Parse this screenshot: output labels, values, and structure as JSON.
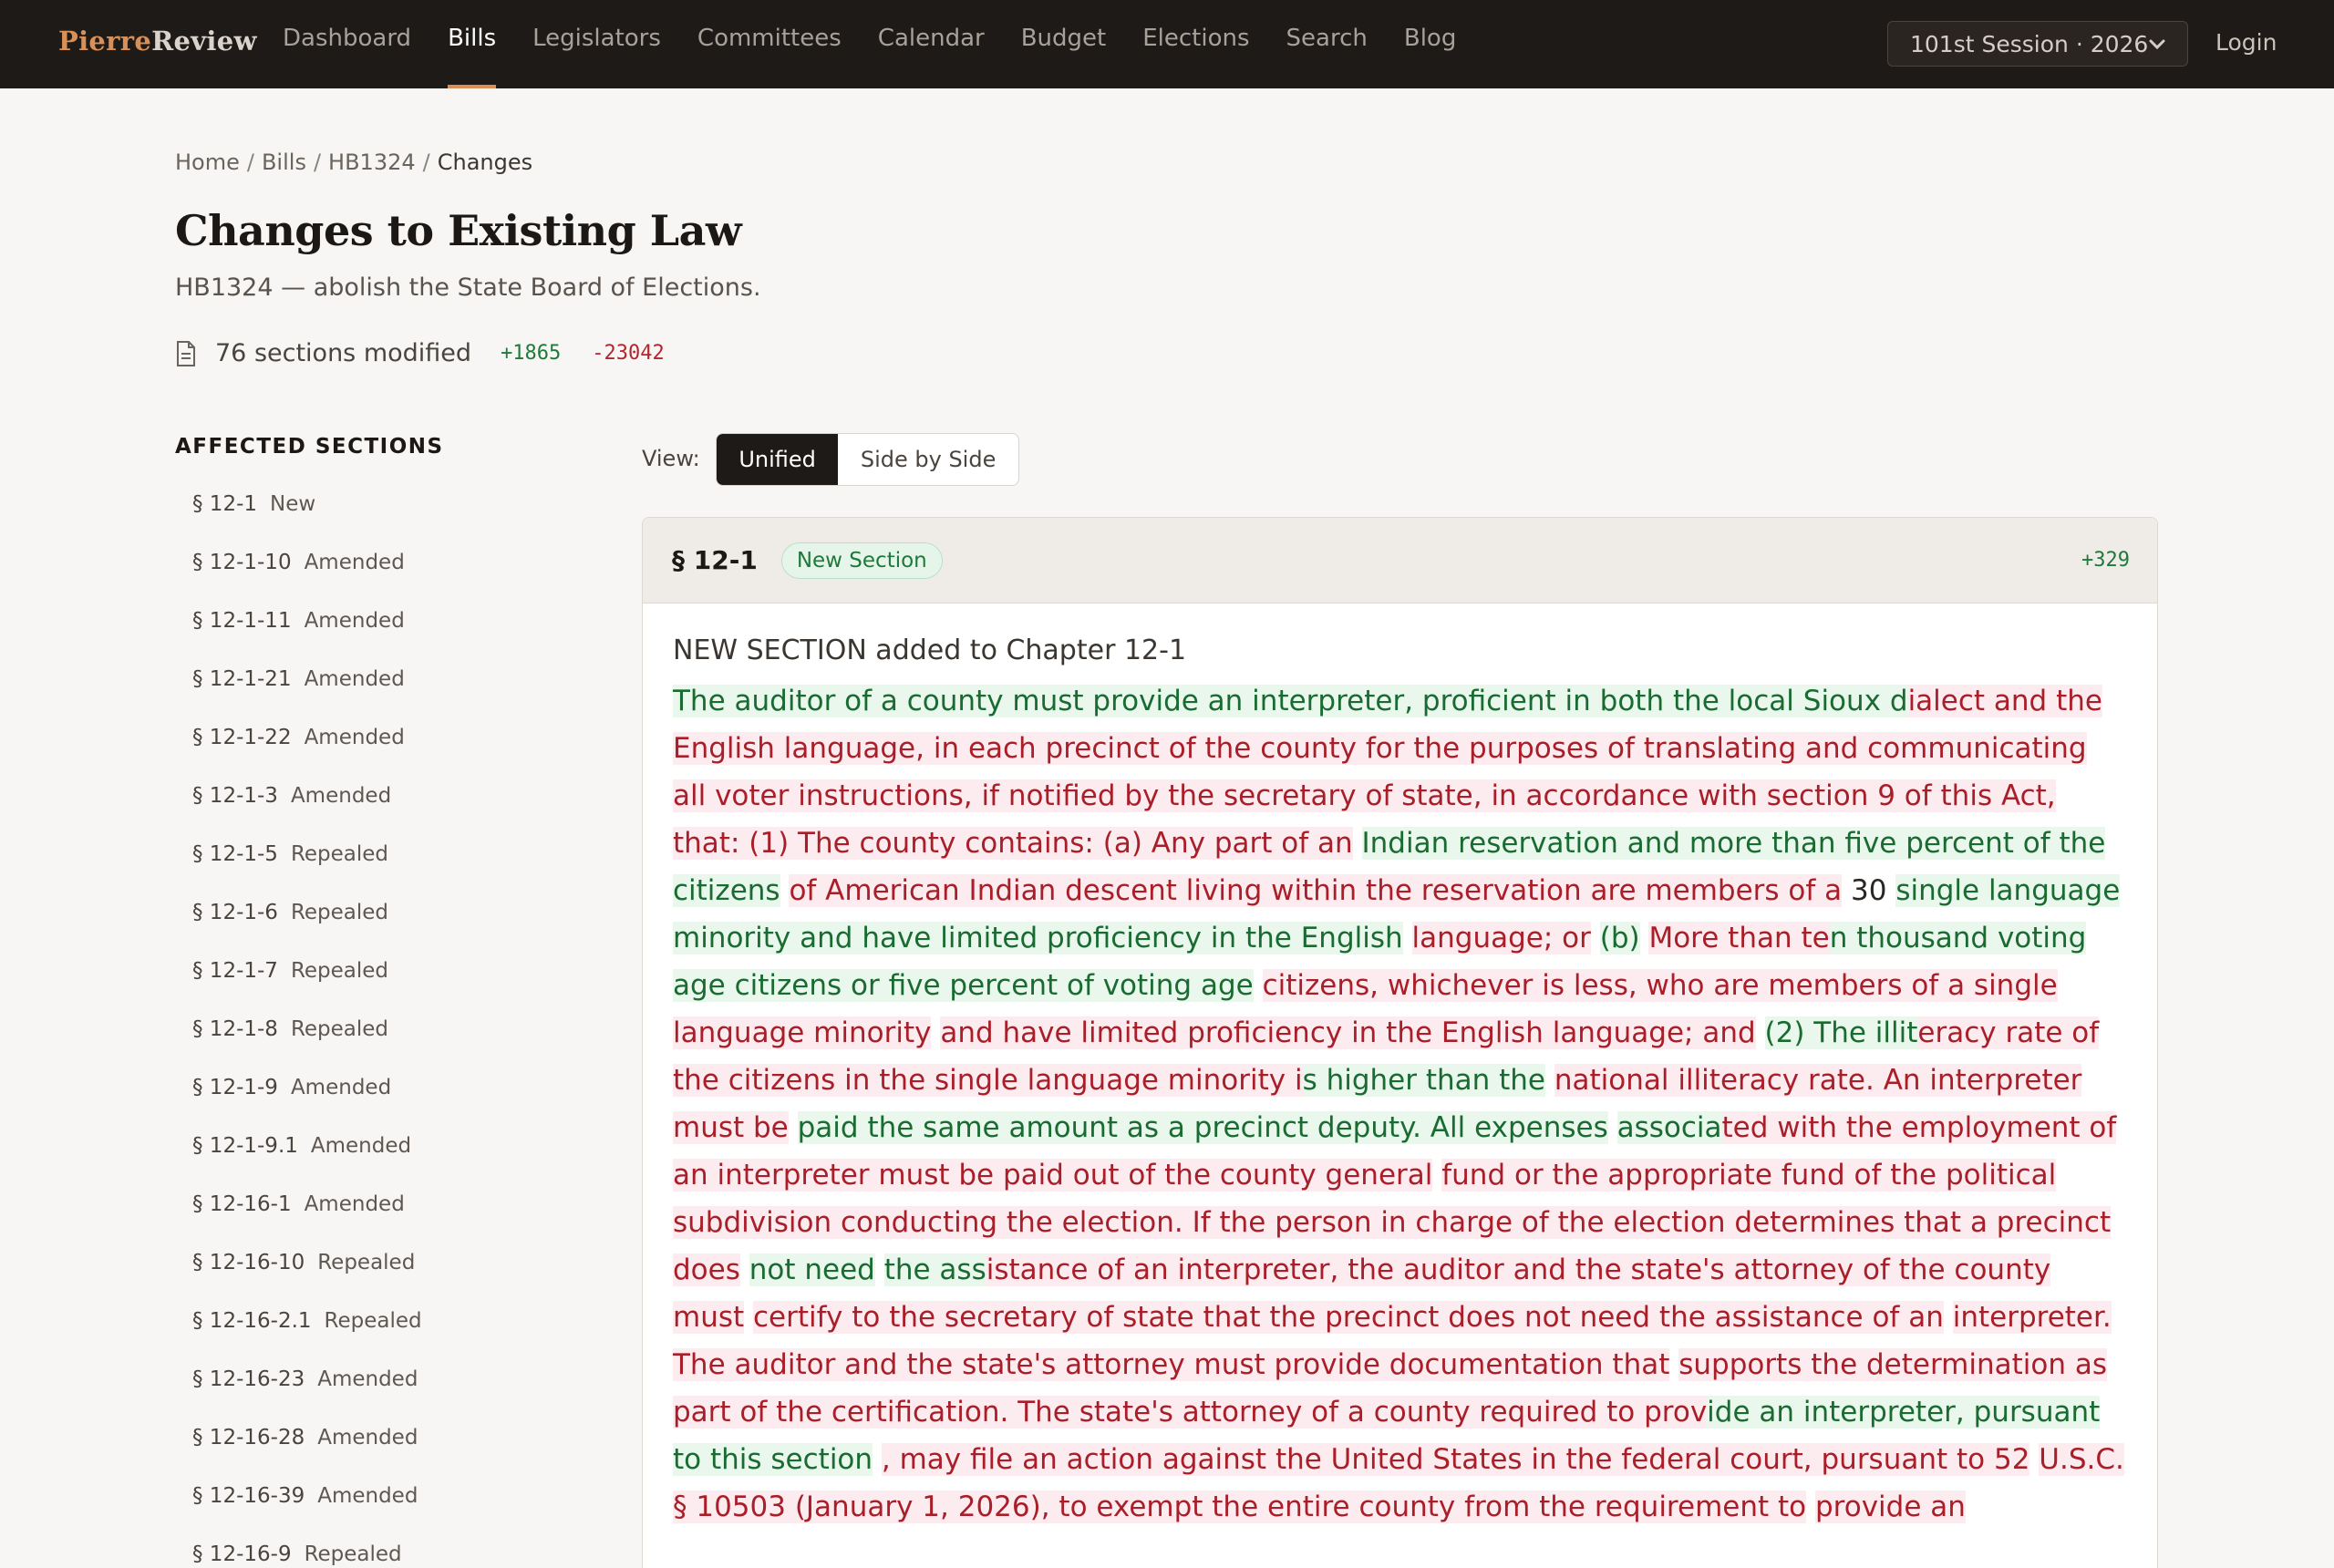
{
  "nav": {
    "logo_part1": "Pierre",
    "logo_part2": "Review",
    "links": [
      "Dashboard",
      "Bills",
      "Legislators",
      "Committees",
      "Calendar",
      "Budget",
      "Elections",
      "Search",
      "Blog"
    ],
    "active": "Bills",
    "session": "101st Session · 2026",
    "login": "Login"
  },
  "breadcrumb": [
    "Home",
    "Bills",
    "HB1324",
    "Changes"
  ],
  "page": {
    "title": "Changes to Existing Law",
    "subtitle": "HB1324 — abolish the State Board of Elections.",
    "sections_modified": "76 sections modified",
    "additions": "+1865",
    "deletions": "-23042"
  },
  "sidebar": {
    "heading": "AFFECTED SECTIONS",
    "items": [
      {
        "section": "§ 12-1",
        "status": "New"
      },
      {
        "section": "§ 12-1-10",
        "status": "Amended"
      },
      {
        "section": "§ 12-1-11",
        "status": "Amended"
      },
      {
        "section": "§ 12-1-21",
        "status": "Amended"
      },
      {
        "section": "§ 12-1-22",
        "status": "Amended"
      },
      {
        "section": "§ 12-1-3",
        "status": "Amended"
      },
      {
        "section": "§ 12-1-5",
        "status": "Repealed"
      },
      {
        "section": "§ 12-1-6",
        "status": "Repealed"
      },
      {
        "section": "§ 12-1-7",
        "status": "Repealed"
      },
      {
        "section": "§ 12-1-8",
        "status": "Repealed"
      },
      {
        "section": "§ 12-1-9",
        "status": "Amended"
      },
      {
        "section": "§ 12-1-9.1",
        "status": "Amended"
      },
      {
        "section": "§ 12-16-1",
        "status": "Amended"
      },
      {
        "section": "§ 12-16-10",
        "status": "Repealed"
      },
      {
        "section": "§ 12-16-2.1",
        "status": "Repealed"
      },
      {
        "section": "§ 12-16-23",
        "status": "Amended"
      },
      {
        "section": "§ 12-16-28",
        "status": "Amended"
      },
      {
        "section": "§ 12-16-39",
        "status": "Amended"
      },
      {
        "section": "§ 12-16-9",
        "status": "Repealed"
      }
    ]
  },
  "view": {
    "label": "View:",
    "options": [
      "Unified",
      "Side by Side"
    ],
    "selected": "Unified"
  },
  "card": {
    "section": "§ 12-1",
    "badge": "New Section",
    "count": "+329",
    "intro": "NEW SECTION added to Chapter 12-1",
    "segments": [
      {
        "type": "add",
        "text": " The auditor of a county must provide an interpreter, proficient in both the local "
      },
      {
        "type": "plain",
        "text": " "
      },
      {
        "type": "add",
        "text": "Sioux d"
      },
      {
        "type": "del",
        "text": "ialect and the English language, in each precinct of the county for the purposes of "
      },
      {
        "type": "plain",
        "text": " "
      },
      {
        "type": "del",
        "text": "translating and communicating all voter instructions, if notified by the secretary of state, "
      },
      {
        "type": "plain",
        "text": " "
      },
      {
        "type": "del",
        "text": "in accordance with section 9 of this Act, that: "
      },
      {
        "type": "plain",
        "text": " "
      },
      {
        "type": "del",
        "text": "(1) The county contains: "
      },
      {
        "type": "plain",
        "text": " "
      },
      {
        "type": "del",
        "text": "(a) Any part of an"
      },
      {
        "type": "plain",
        "text": " "
      },
      {
        "type": "add",
        "text": "Indian reservation and more than five percent of the citizens"
      },
      {
        "type": "plain",
        "text": " "
      },
      {
        "type": "del",
        "text": "of American Indian descent living within the reservation are members of a"
      },
      {
        "type": "plain",
        "text": " 30 "
      },
      {
        "type": "add",
        "text": "single language minority and have limited proficiency in the English"
      },
      {
        "type": "plain",
        "text": " "
      },
      {
        "type": "del",
        "text": "language; or"
      },
      {
        "type": "plain",
        "text": " "
      },
      {
        "type": "add",
        "text": "(b)"
      },
      {
        "type": "plain",
        "text": " "
      },
      {
        "type": "del",
        "text": "More than te"
      },
      {
        "type": "add",
        "text": "n thousand voting age citizens or five percent of voting age"
      },
      {
        "type": "plain",
        "text": " "
      },
      {
        "type": "del",
        "text": "citizens, whichever is less, who are members of a single language minority"
      },
      {
        "type": "plain",
        "text": " "
      },
      {
        "type": "del",
        "text": "and have limited proficiency in the English language; and"
      },
      {
        "type": "plain",
        "text": " "
      },
      {
        "type": "add",
        "text": "(2) The illit"
      },
      {
        "type": "del",
        "text": "eracy rate of the citizens in the single language minority i"
      },
      {
        "type": "add",
        "text": "s higher than the"
      },
      {
        "type": "plain",
        "text": " "
      },
      {
        "type": "del",
        "text": "national illiteracy rate. "
      },
      {
        "type": "plain",
        "text": " "
      },
      {
        "type": "del",
        "text": "An interpreter must be"
      },
      {
        "type": "plain",
        "text": " "
      },
      {
        "type": "add",
        "text": "paid the same amount as a precinct deputy. All expenses"
      },
      {
        "type": "plain",
        "text": " "
      },
      {
        "type": "add",
        "text": "associa"
      },
      {
        "type": "del",
        "text": "ted with the employment of an interpreter must be paid out of the county general"
      },
      {
        "type": "plain",
        "text": " "
      },
      {
        "type": "del",
        "text": "fund or the appropriate fund of the political subdivision conducting the election. "
      },
      {
        "type": "plain",
        "text": " "
      },
      {
        "type": "del",
        "text": "If the person in charge of the election determines that a precinct does"
      },
      {
        "type": "plain",
        "text": " "
      },
      {
        "type": "add",
        "text": "not need"
      },
      {
        "type": "plain",
        "text": " "
      },
      {
        "type": "add",
        "text": "the ass"
      },
      {
        "type": "del",
        "text": "istance of an interpreter, the auditor and the state's attorney of the county must"
      },
      {
        "type": "plain",
        "text": " "
      },
      {
        "type": "del",
        "text": "certify to the secretary of state that the precinct does not need the assistance of an"
      },
      {
        "type": "plain",
        "text": " "
      },
      {
        "type": "del",
        "text": "interpreter. The auditor and the state's attorney must provide documentation that"
      },
      {
        "type": "plain",
        "text": " "
      },
      {
        "type": "del",
        "text": "supports the determination as part of the certification. "
      },
      {
        "type": "plain",
        "text": " "
      },
      {
        "type": "del",
        "text": "The state's attorney of a county required to prov"
      },
      {
        "type": "add",
        "text": "ide an interpreter, pursuant to this section"
      },
      {
        "type": "plain",
        "text": " "
      },
      {
        "type": "del",
        "text": ", may file an action against the United States in the federal court, pursuant to 52"
      },
      {
        "type": "plain",
        "text": " "
      },
      {
        "type": "del",
        "text": "U.S.C. § 10503 (January 1, 2026), to exempt the entire county from the requirement to"
      },
      {
        "type": "plain",
        "text": " "
      },
      {
        "type": "del",
        "text": "provide an"
      }
    ]
  },
  "colors": {
    "nav_bg": "#1e1a17",
    "accent": "#d98f55",
    "added_text": "#1a6b32",
    "added_bg": "#eaf7ed",
    "deleted_text": "#a81f2a",
    "deleted_bg": "#fdecef"
  }
}
